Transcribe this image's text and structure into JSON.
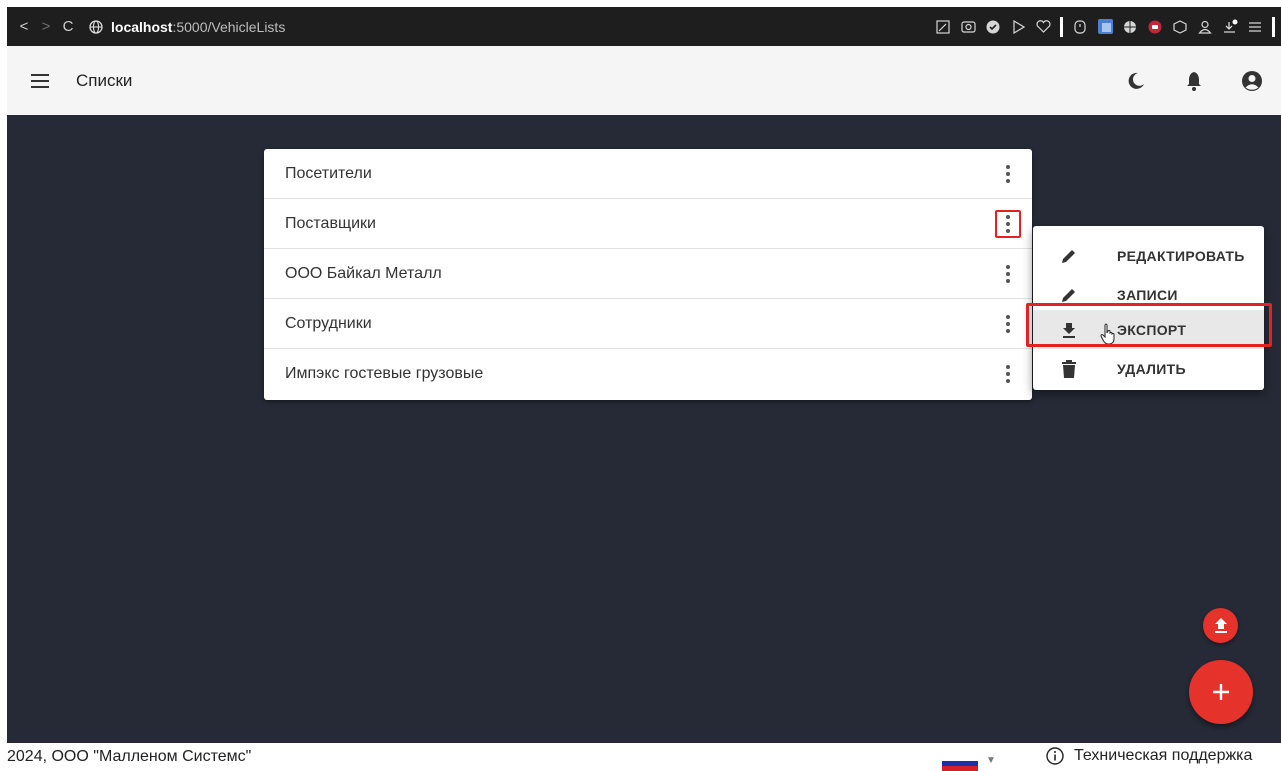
{
  "browser": {
    "url_host": "localhost",
    "url_path": ":5000/VehicleLists",
    "back_glyph": "<",
    "forward_glyph": ">",
    "reload_glyph": "C"
  },
  "app_bar": {
    "title": "Списки"
  },
  "lists": {
    "items": [
      {
        "label": "Посетители"
      },
      {
        "label": "Поставщики"
      },
      {
        "label": "ООО Байкал Металл"
      },
      {
        "label": "Сотрудники"
      },
      {
        "label": "Импэкс гостевые грузовые"
      }
    ]
  },
  "context_menu": {
    "items": [
      {
        "label": "РЕДАКТИРОВАТЬ",
        "icon": "pencil-icon"
      },
      {
        "label": "ЗАПИСИ",
        "icon": "pencil-icon"
      },
      {
        "label": "ЭКСПОРТ",
        "icon": "download-icon"
      },
      {
        "label": "УДАЛИТЬ",
        "icon": "trash-icon"
      }
    ]
  },
  "footer": {
    "copyright": "2024, ООО \"Малленом Системс\"",
    "support": "Техническая поддержка"
  },
  "colors": {
    "accent": "#e5322b",
    "highlight": "#e52222",
    "main_bg": "#252a36"
  }
}
